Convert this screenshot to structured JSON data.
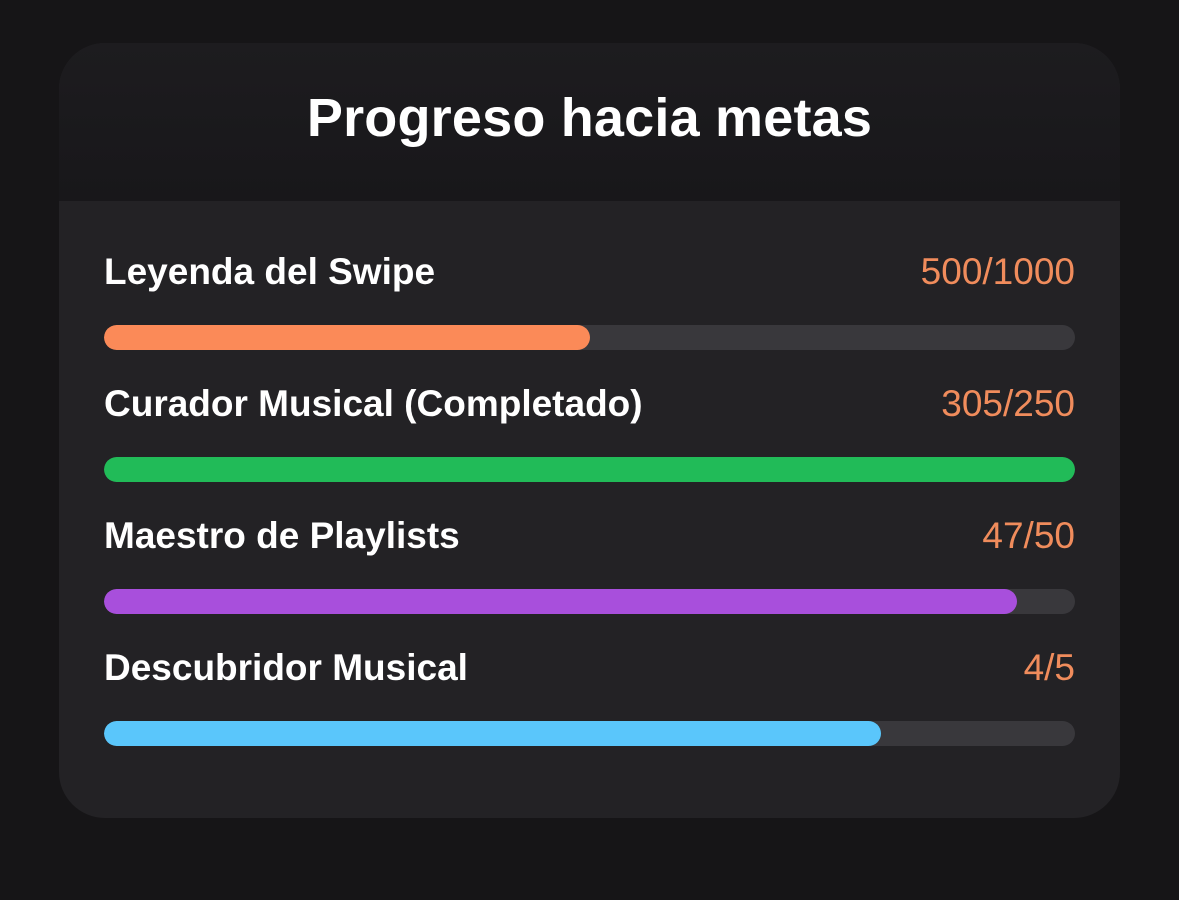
{
  "card": {
    "title": "Progreso hacia metas"
  },
  "goals": [
    {
      "label": "Leyenda del Swipe",
      "value": "500/1000",
      "progress": 0.5,
      "color": "#fb8a58"
    },
    {
      "label": "Curador Musical (Completado)",
      "value": "305/250",
      "progress": 1.0,
      "color": "#21bb58"
    },
    {
      "label": "Maestro de Playlists",
      "value": "47/50",
      "progress": 0.94,
      "color": "#a84fdc"
    },
    {
      "label": "Descubridor Musical",
      "value": "4/5",
      "progress": 0.8,
      "color": "#5ac6fb"
    }
  ],
  "colors": {
    "background": "#161517",
    "card": "#232225",
    "track": "#39383c",
    "value_text": "#f08c5c"
  }
}
